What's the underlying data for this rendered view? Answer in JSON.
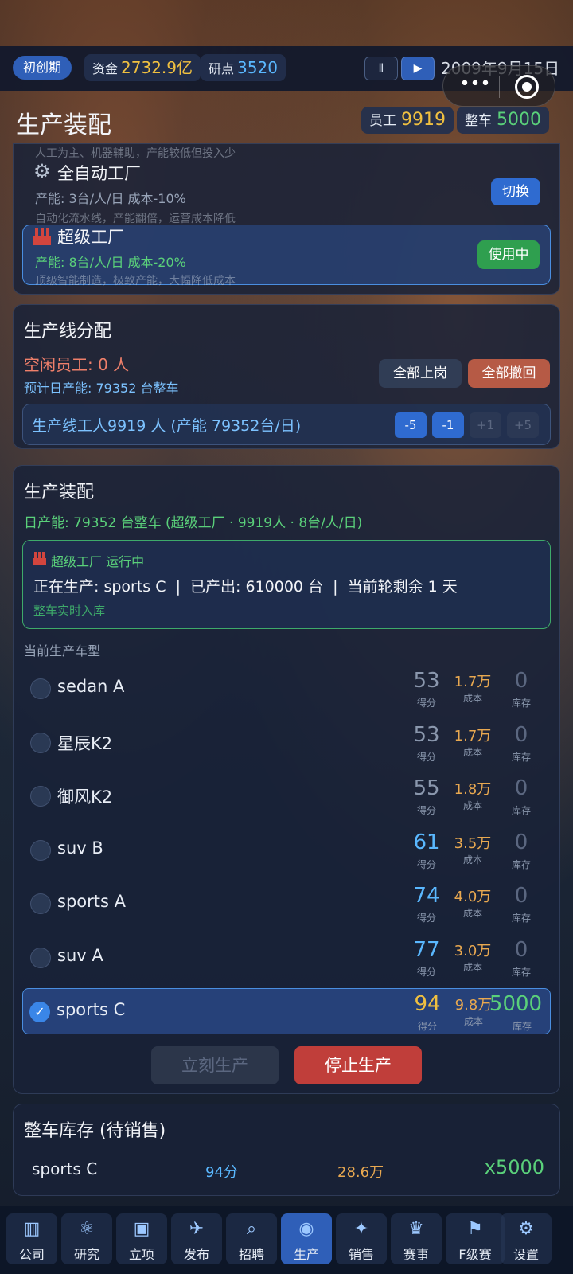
{
  "status_bar": {
    "phase": "初创期",
    "funds_label": "资金",
    "funds_value": "2732.9亿",
    "research_label": "研点",
    "research_value": "3520",
    "pause_icon": "pause-icon",
    "play_icon": "play-icon",
    "date": "2009年9月15日"
  },
  "header": {
    "title": "生产装配",
    "staff_label": "员工",
    "staff_value": "9919",
    "cars_label": "整车",
    "cars_value": "5000"
  },
  "factory_panel": {
    "top_desc": "人工为主、机器辅助，产能较低但投入少",
    "auto": {
      "icon": "gear-icon",
      "name": "全自动工厂",
      "capacity": "产能: 3台/人/日  成本-10%",
      "desc": "自动化流水线，产能翻倍，运营成本降低",
      "button": "切换"
    },
    "super": {
      "icon": "factory-icon",
      "name": "超级工厂",
      "capacity": "产能: 8台/人/日  成本-20%",
      "desc": "顶级智能制造，极致产能，大幅降低成本",
      "button": "使用中"
    }
  },
  "line_panel": {
    "title": "生产线分配",
    "idle": "空闲员工: 0 人",
    "daily": "预计日产能: 79352 台整车",
    "all_on": "全部上岗",
    "all_off": "全部撤回",
    "line_text": "生产线工人9919 人 (产能 79352台/日)",
    "steps": [
      "-5",
      "-1",
      "+1",
      "+5"
    ]
  },
  "assembly_panel": {
    "title": "生产装配",
    "daily": "日产能: 79352 台整车 (超级工厂 · 9919人 · 8台/人/日)",
    "status_icon": "factory-icon",
    "status_title": "超级工厂 运行中",
    "status_line": "正在生产: sports C  |  已产出: 610000 台  |  当前轮剩余 1 天",
    "status_note": "整车实时入库",
    "models_label": "当前生产车型",
    "score_label": "得分",
    "cost_label": "成本",
    "stock_label": "库存",
    "models": [
      {
        "name": "sedan A",
        "score": "53",
        "cost": "1.7万",
        "stock": "0"
      },
      {
        "name": "星辰K2",
        "score": "53",
        "cost": "1.7万",
        "stock": "0"
      },
      {
        "name": "御风K2",
        "score": "55",
        "cost": "1.8万",
        "stock": "0"
      },
      {
        "name": "suv B",
        "score": "61",
        "cost": "3.5万",
        "stock": "0"
      },
      {
        "name": "sports A",
        "score": "74",
        "cost": "4.0万",
        "stock": "0"
      },
      {
        "name": "suv A",
        "score": "77",
        "cost": "3.0万",
        "stock": "0"
      },
      {
        "name": "sports C",
        "score": "94",
        "cost": "9.8万",
        "stock": "5000"
      }
    ],
    "produce_now": "立刻生产",
    "stop": "停止生产"
  },
  "inventory_panel": {
    "title": "整车库存 (待销售)",
    "item_name": "sports C",
    "item_score": "94分",
    "item_price": "28.6万",
    "item_qty": "x5000"
  },
  "nav": [
    {
      "label": "公司",
      "icon": "building-icon"
    },
    {
      "label": "研究",
      "icon": "research-icon"
    },
    {
      "label": "立项",
      "icon": "monitor-icon"
    },
    {
      "label": "发布",
      "icon": "rocket-icon"
    },
    {
      "label": "招聘",
      "icon": "magnify-icon"
    },
    {
      "label": "生产",
      "icon": "car-icon"
    },
    {
      "label": "销售",
      "icon": "sales-icon"
    },
    {
      "label": "赛事",
      "icon": "trophy-icon"
    },
    {
      "label": "F级赛",
      "icon": "race-icon"
    },
    {
      "label": "设置",
      "icon": "settings-icon"
    }
  ],
  "colors": {
    "accent": "#2f5fb8",
    "green": "#5ad07a",
    "orange": "#e8a850",
    "red": "#c24a3e",
    "idle_red": "#ef7f6a"
  }
}
